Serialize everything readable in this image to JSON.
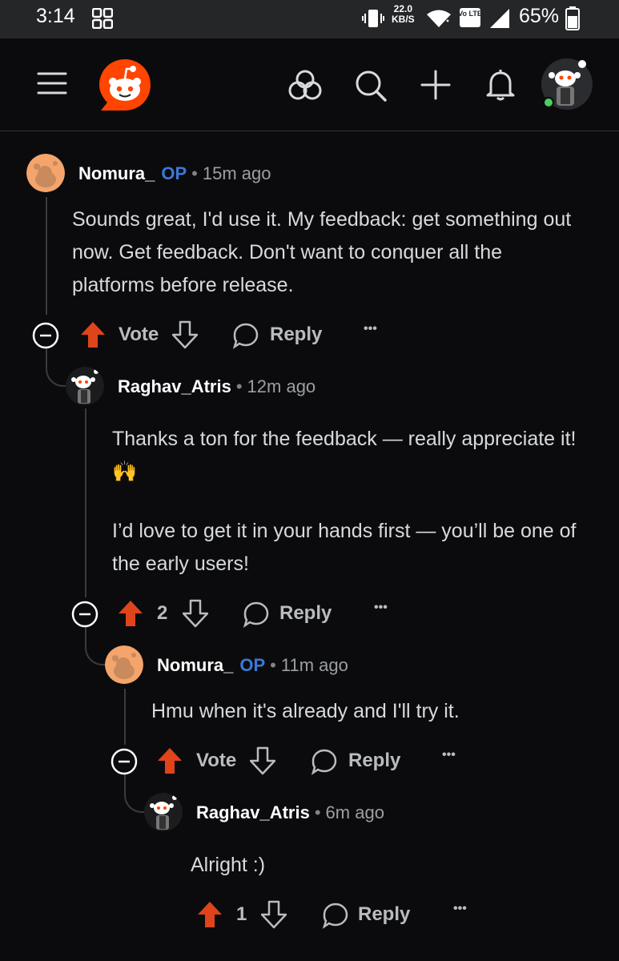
{
  "status_bar": {
    "time": "3:14",
    "net_speed_value": "22.0",
    "net_speed_unit": "KB/S",
    "volte": "Vo LTE",
    "battery": "65%"
  },
  "app_bar": {
    "icons": [
      "menu-icon",
      "reddit-logo",
      "communities-icon",
      "search-icon",
      "plus-icon",
      "bell-icon",
      "avatar"
    ]
  },
  "comments": [
    {
      "username": "Nomura_",
      "op": "OP",
      "time": "15m ago",
      "body": [
        "Sounds great, I'd use it. My feedback: get something out now. Get feedback. Don't want to conquer all the platforms before release."
      ],
      "vote": "Vote",
      "reply": "Reply",
      "more": "•••"
    },
    {
      "username": "Raghav_Atris",
      "time": "12m ago",
      "body": [
        "Thanks a ton for the feedback — really appreciate it! 🙌",
        "I’d love to get it in your hands first — you’ll be one of the early users!"
      ],
      "vote": "2",
      "reply": "Reply",
      "more": "•••"
    },
    {
      "username": "Nomura_",
      "op": "OP",
      "time": "11m ago",
      "body": [
        "Hmu when it's already and I'll try it."
      ],
      "vote": "Vote",
      "reply": "Reply",
      "more": "•••"
    },
    {
      "username": "Raghav_Atris",
      "time": "6m ago",
      "body": [
        "Alright :)"
      ],
      "vote": "1",
      "reply": "Reply",
      "more": "•••"
    }
  ],
  "colors": {
    "upvote": "#e0441b",
    "op": "#3b78d8",
    "reddit_orange": "#ff4500",
    "background": "#0b0b0d"
  }
}
